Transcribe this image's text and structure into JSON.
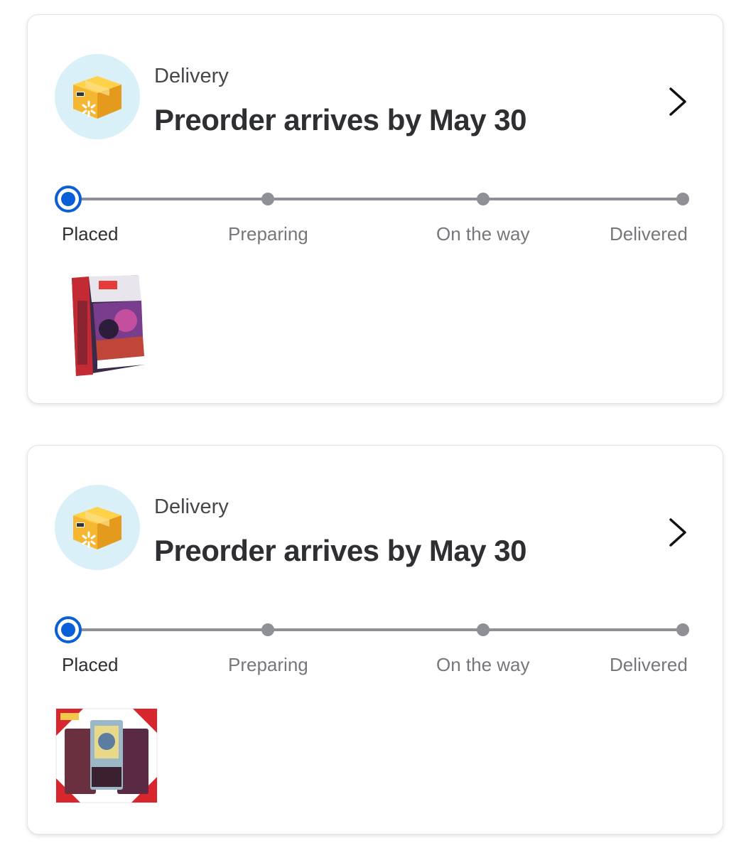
{
  "orders": [
    {
      "kind": "Delivery",
      "headline": "Preorder arrives by May 30",
      "steps": [
        "Placed",
        "Preparing",
        "On the way",
        "Delivered"
      ],
      "current_step": 0,
      "item_image": "booster-bundle-box"
    },
    {
      "kind": "Delivery",
      "headline": "Preorder arrives by May 30",
      "steps": [
        "Placed",
        "Preparing",
        "On the way",
        "Delivered"
      ],
      "current_step": 0,
      "item_image": "three-pack-blister"
    }
  ],
  "colors": {
    "accent": "#0a5fd8",
    "track": "#8e9096",
    "avatar_bg": "#d9f0f8",
    "box": "#f5b731"
  }
}
